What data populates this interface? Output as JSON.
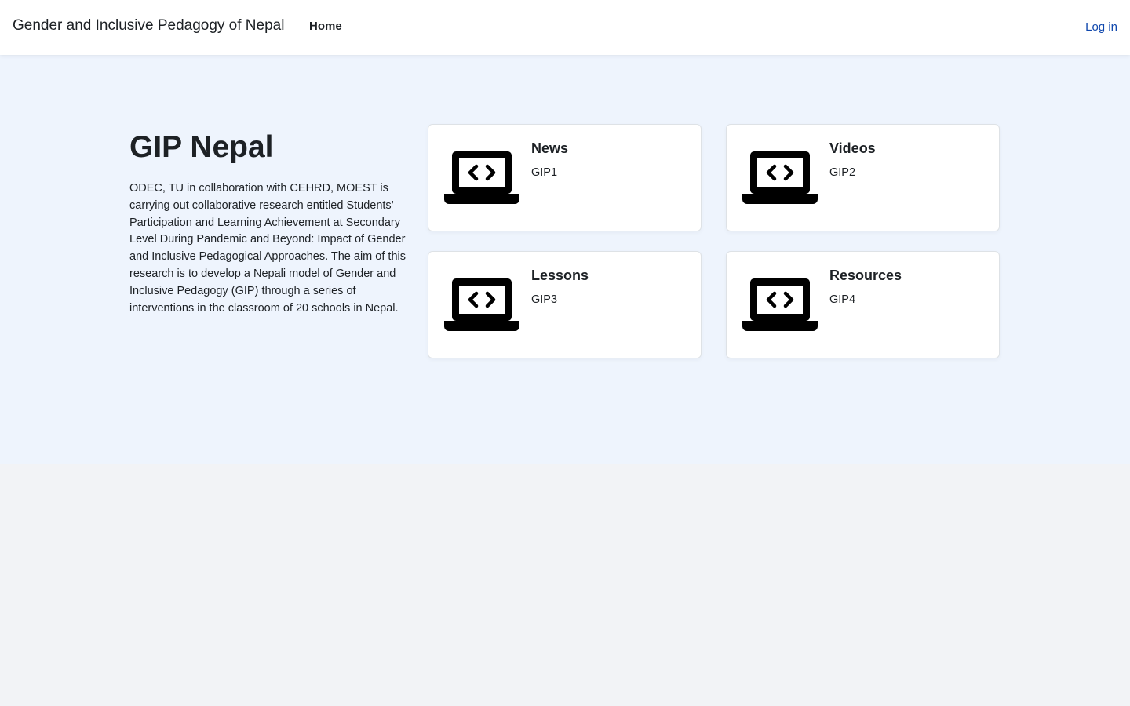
{
  "header": {
    "site_name": "Gender and Inclusive Pedagogy of Nepal",
    "nav_home": "Home",
    "login": "Log in"
  },
  "intro": {
    "heading": "GIP Nepal",
    "description": "ODEC, TU in collaboration with CEHRD, MOEST is carrying out collaborative research entitled Students’ Participation and Learning Achievement at Secondary Level During Pandemic and Beyond: Impact of Gender and Inclusive Pedagogical Approaches. The aim of this research is to develop a Nepali model of Gender and Inclusive Pedagogy (GIP) through a series of interventions in the classroom of 20 schools in Nepal."
  },
  "cards": [
    {
      "title": "News",
      "subtitle": "GIP1",
      "icon": "laptop-code-icon"
    },
    {
      "title": "Videos",
      "subtitle": "GIP2",
      "icon": "laptop-code-icon"
    },
    {
      "title": "Lessons",
      "subtitle": "GIP3",
      "icon": "laptop-code-icon"
    },
    {
      "title": "Resources",
      "subtitle": "GIP4",
      "icon": "laptop-code-icon"
    }
  ],
  "colors": {
    "hero_background": "#eef4fd",
    "page_background": "#f2f3f6",
    "link": "#0f47ad",
    "text": "#1d2125"
  }
}
